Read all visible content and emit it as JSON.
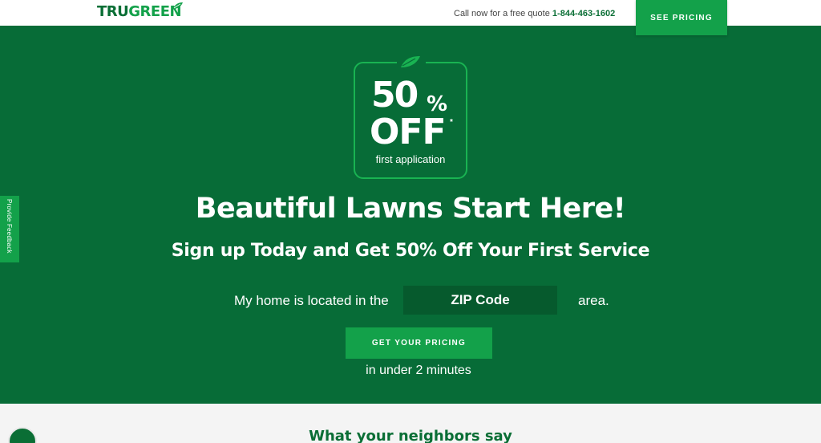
{
  "header": {
    "logo_part1": "TRU",
    "logo_part2": "GREEN",
    "callnow_text": "Call now for a free quote",
    "phone": "1-844-463-1602",
    "see_pricing_label": "SEE PRICING"
  },
  "hero": {
    "badge": {
      "big_number": "50",
      "percent": "%",
      "off": "OFF",
      "asterisk": "*",
      "caption": "first application",
      "icon": "leaf-icon"
    },
    "headline": "Beautiful Lawns Start Here!",
    "subhead": "Sign up Today and Get 50% Off Your First Service",
    "zip_prefix": "My home is located in the",
    "zip_placeholder": "ZIP Code",
    "zip_value": "",
    "zip_suffix": "area.",
    "cta_label": "GET YOUR PRICING",
    "cta_caption": "in under 2 minutes"
  },
  "feedback_tab": {
    "label": "Provide Feedback"
  },
  "reviews": {
    "heading": "What your neighbors say"
  },
  "colors": {
    "brand_dark": "#076c37",
    "brand_bright": "#13a14a",
    "input_bg": "#065a2d",
    "section_bg": "#f4f4f4"
  }
}
